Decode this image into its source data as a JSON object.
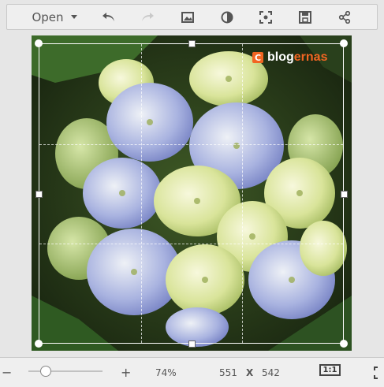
{
  "toolbar": {
    "open_label": "Open",
    "icons": [
      "undo-icon",
      "redo-icon",
      "image-icon",
      "contrast-icon",
      "focus-icon",
      "save-icon",
      "share-icon"
    ]
  },
  "image": {
    "logo_prefix": "blog",
    "logo_suffix": "ernas",
    "logo_mark": "C"
  },
  "bottom": {
    "zoom_out": "−",
    "zoom_in": "+",
    "zoom_percent": "74%",
    "width": "551",
    "x_sep": "X",
    "height": "542",
    "ratio": "1:1"
  },
  "colors": {
    "accent": "#f26522",
    "toolbar_bg": "#efefef",
    "canvas_bg": "#e6e6e6"
  }
}
